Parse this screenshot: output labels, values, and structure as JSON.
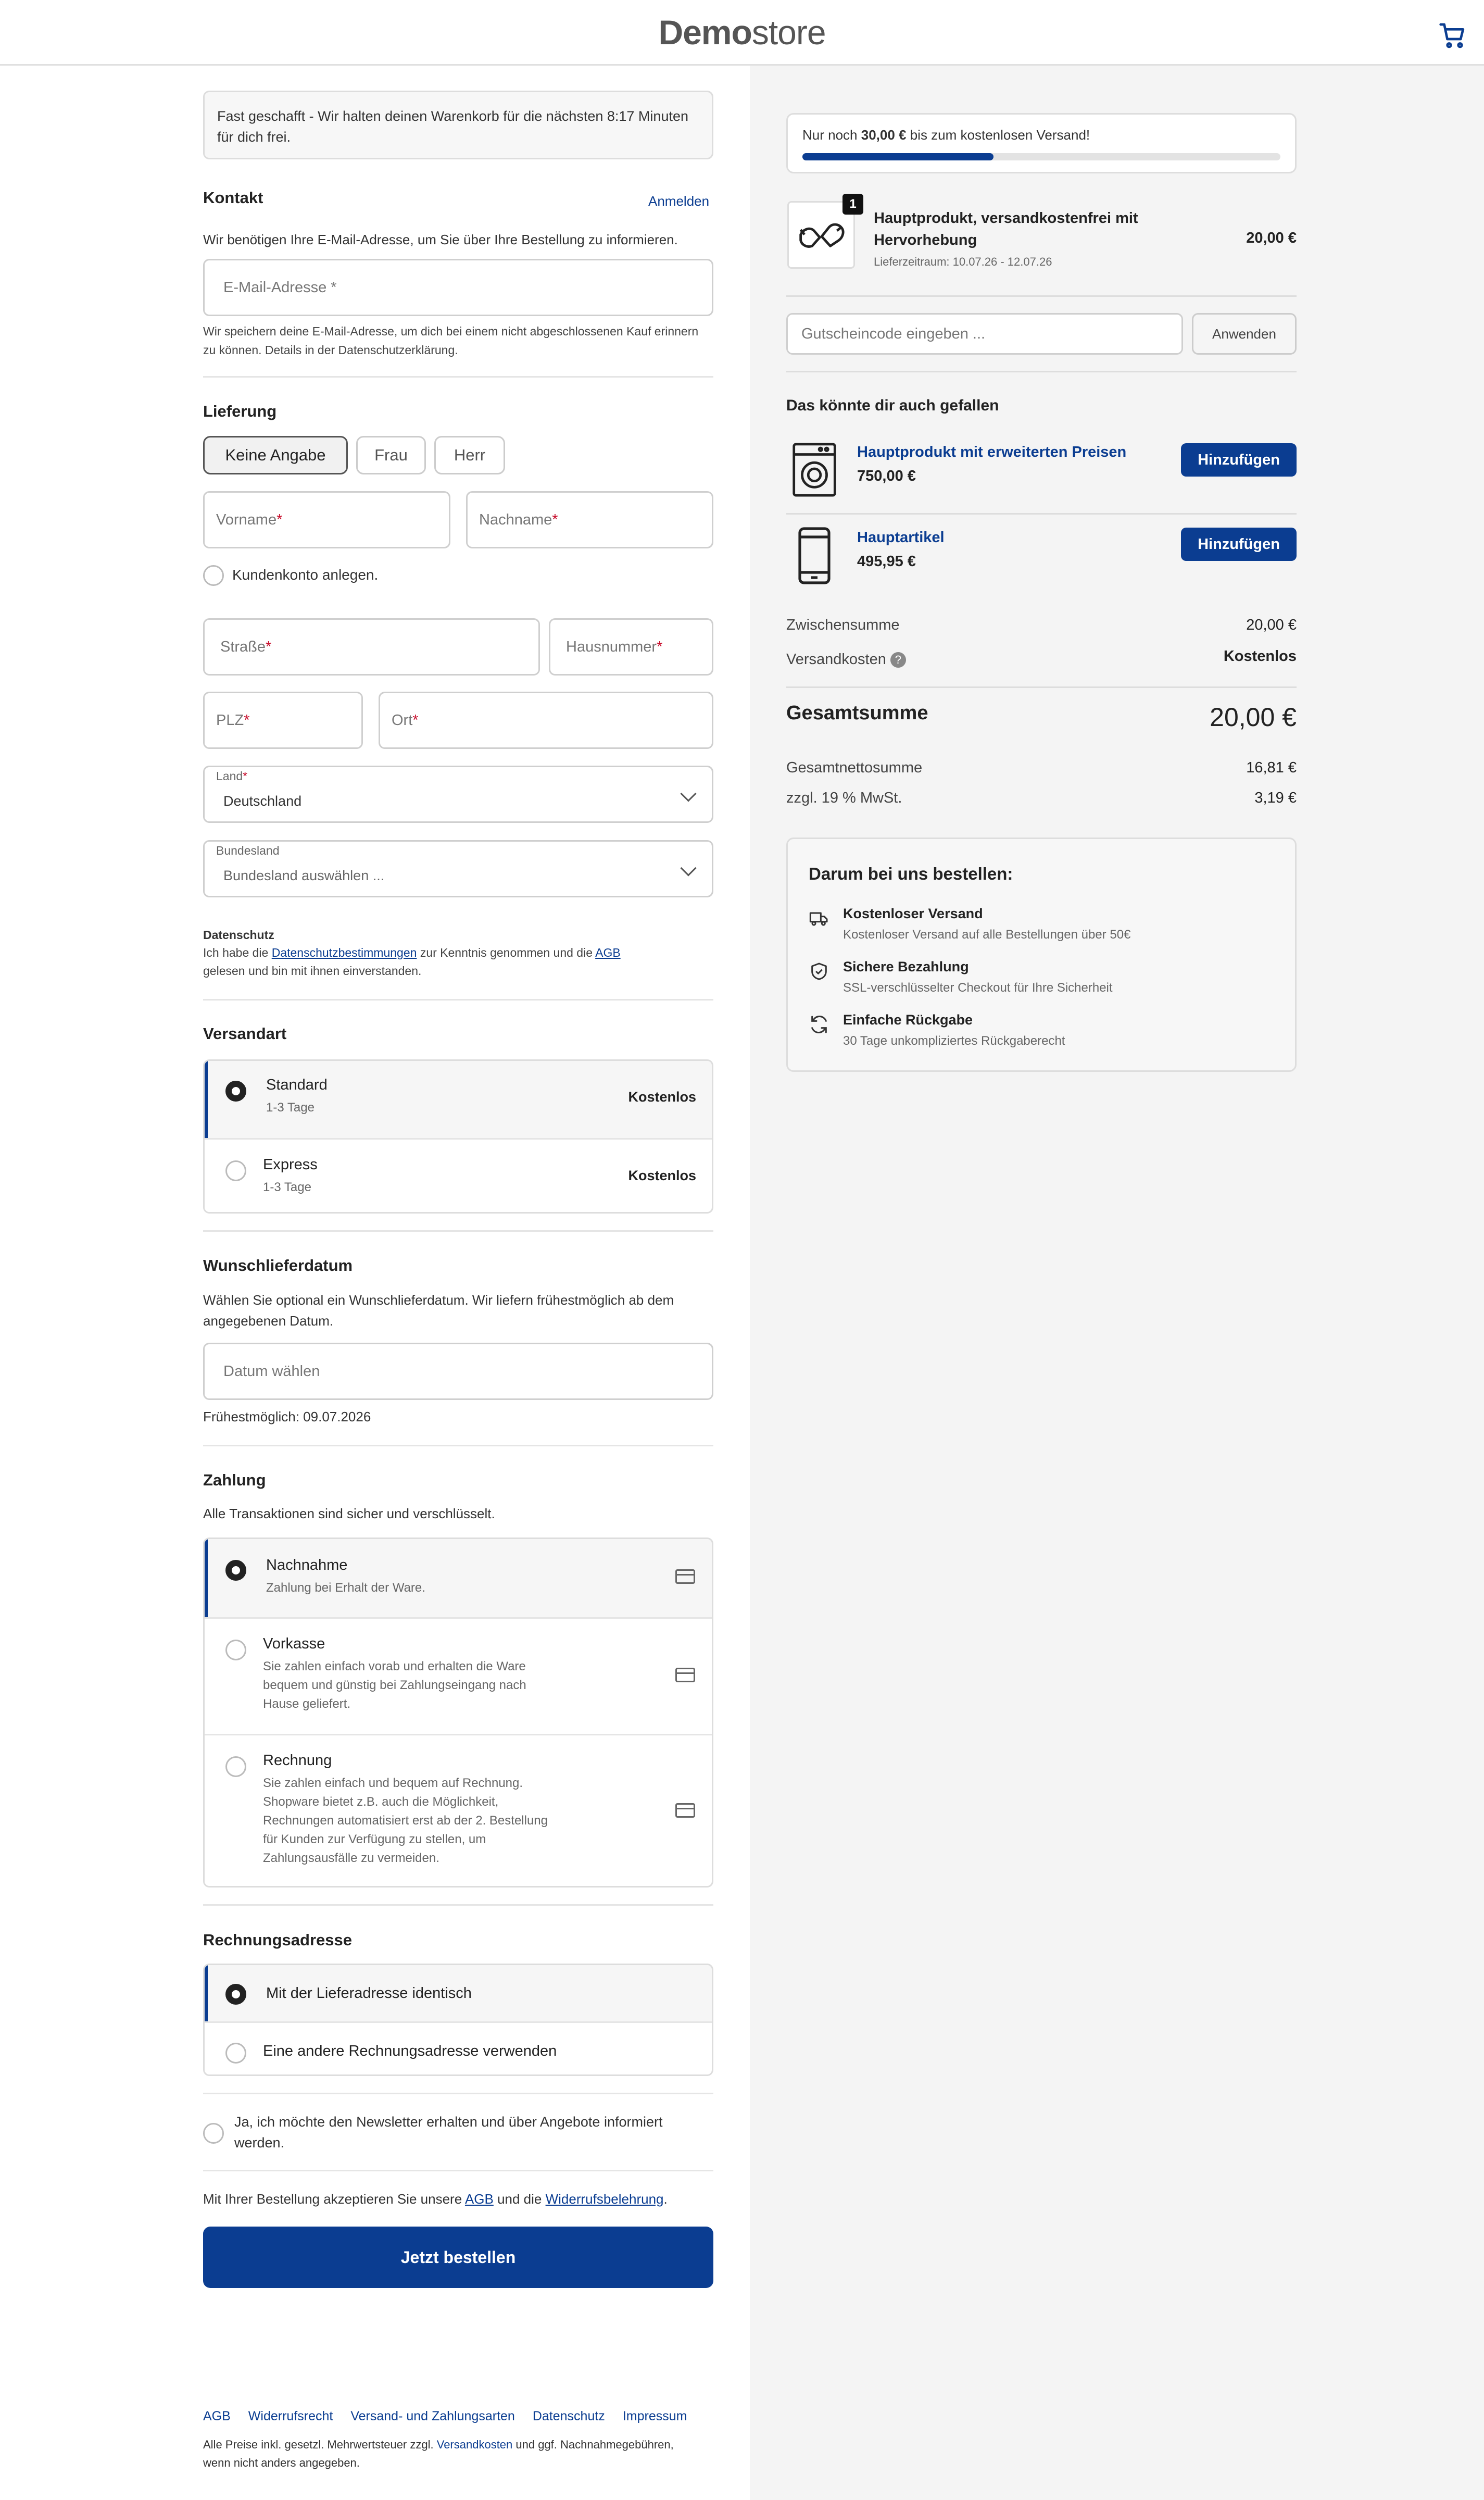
{
  "header": {
    "logo_bold": "Demo",
    "logo_light": "store"
  },
  "notice": "Fast geschafft - Wir halten deinen Warenkorb für die nächsten 8:17 Minuten für dich frei.",
  "contact": {
    "title": "Kontakt",
    "login": "Anmelden",
    "hint": "Wir benötigen Ihre E-Mail-Adresse, um Sie über Ihre Bestellung zu informieren.",
    "email_placeholder": "E-Mail-Adresse *",
    "email_note": "Wir speichern deine E-Mail-Adresse, um dich bei einem nicht abgeschlossenen Kauf erinnern zu können. Details in der Datenschutzerklärung."
  },
  "delivery": {
    "title": "Lieferung",
    "salutations": [
      "Keine Angabe",
      "Frau",
      "Herr"
    ],
    "firstname": "Vorname",
    "lastname": "Nachname",
    "create_account": "Kundenkonto anlegen.",
    "street": "Straße",
    "housenumber": "Hausnummer",
    "zip": "PLZ",
    "city": "Ort",
    "country_label": "Land",
    "country_value": "Deutschland",
    "state_label": "Bundesland",
    "state_value": "Bundesland auswählen ...",
    "privacy_title": "Datenschutz",
    "privacy_pre": "Ich habe die ",
    "privacy_link": "Datenschutzbestimmungen",
    "privacy_mid": " zur Kenntnis genommen und die ",
    "privacy_agb": "AGB",
    "privacy_post": "gelesen und bin mit ihnen einverstanden."
  },
  "shipping": {
    "title": "Versandart",
    "options": [
      {
        "name": "Standard",
        "sub": "1-3 Tage",
        "price": "Kostenlos"
      },
      {
        "name": "Express",
        "sub": "1-3 Tage",
        "price": "Kostenlos"
      }
    ]
  },
  "wish_date": {
    "title": "Wunschlieferdatum",
    "text": "Wählen Sie optional ein Wunschlieferdatum. Wir liefern frühestmöglich ab dem angegebenen Datum.",
    "placeholder": "Datum wählen",
    "earliest": "Frühestmöglich: 09.07.2026"
  },
  "payment": {
    "title": "Zahlung",
    "text": "Alle Transaktionen sind sicher und verschlüsselt.",
    "options": [
      {
        "name": "Nachnahme",
        "lines": [
          "Zahlung bei Erhalt der Ware."
        ]
      },
      {
        "name": "Vorkasse",
        "lines": [
          "Sie zahlen einfach vorab und erhalten die Ware",
          "bequem und günstig bei Zahlungseingang nach",
          "Hause geliefert."
        ]
      },
      {
        "name": "Rechnung",
        "lines": [
          "Sie zahlen einfach und bequem auf Rechnung.",
          "Shopware bietet z.B. auch die Möglichkeit,",
          "Rechnungen automatisiert erst ab der 2. Bestellung",
          "für Kunden zur Verfügung zu stellen, um",
          "Zahlungsausfälle zu vermeiden."
        ]
      }
    ]
  },
  "billing": {
    "title": "Rechnungsadresse",
    "options": [
      "Mit der Lieferadresse identisch",
      "Eine andere Rechnungsadresse verwenden"
    ]
  },
  "newsletter": "Ja, ich möchte den Newsletter erhalten und über Angebote informiert werden.",
  "terms": {
    "pre": "Mit Ihrer Bestellung akzeptieren Sie unsere ",
    "agb": "AGB",
    "mid": " und die ",
    "link": "Widerrufsbelehrung",
    "post": "."
  },
  "order_button": "Jetzt bestellen",
  "footer": {
    "links": [
      "AGB",
      "Widerrufsrecht",
      "Versand- und Zahlungsarten",
      "Datenschutz",
      "Impressum"
    ],
    "note_pre": "Alle Preise inkl. gesetzl. Mehrwertsteuer zzgl. ",
    "note_link": "Versandkosten",
    "note_post": " und ggf. Nachnahmegebühren,",
    "note_line2": "wenn nicht anders angegeben."
  },
  "summary": {
    "free_ship_pre": "Nur noch ",
    "free_ship_amount": "30,00 €",
    "free_ship_post": " bis zum kostenlosen Versand!",
    "progress": 0.4,
    "item": {
      "qty": "1",
      "name_line1": "Hauptprodukt, versandkostenfrei mit",
      "name_line2": "Hervorhebung",
      "delivery": "Lieferzeitraum: 10.07.26 - 12.07.26",
      "price": "20,00 €"
    },
    "voucher_placeholder": "Gutscheincode eingeben ...",
    "voucher_button": "Anwenden",
    "cross_title": "Das könnte dir auch gefallen",
    "cross": [
      {
        "name": "Hauptprodukt mit erweiterten Preisen",
        "price": "750,00 €",
        "button": "Hinzufügen"
      },
      {
        "name": "Hauptartikel",
        "price": "495,95 €",
        "button": "Hinzufügen"
      }
    ],
    "subtotal_label": "Zwischensumme",
    "subtotal": "20,00 €",
    "shipping_label": "Versandkosten",
    "shipping": "Kostenlos",
    "total_label": "Gesamtsumme",
    "total": "20,00 €",
    "net_label": "Gesamtnettosumme",
    "net": "16,81 €",
    "tax_label": "zzgl. 19 % MwSt.",
    "tax": "3,19 €"
  },
  "why": {
    "title": "Darum bei uns bestellen:",
    "items": [
      {
        "title": "Kostenloser Versand",
        "sub": "Kostenloser Versand auf alle Bestellungen über 50€"
      },
      {
        "title": "Sichere Bezahlung",
        "sub": "SSL-verschlüsselter Checkout für Ihre Sicherheit"
      },
      {
        "title": "Einfache Rückgabe",
        "sub": "30 Tage unkompliziertes Rückgaberecht"
      }
    ]
  }
}
